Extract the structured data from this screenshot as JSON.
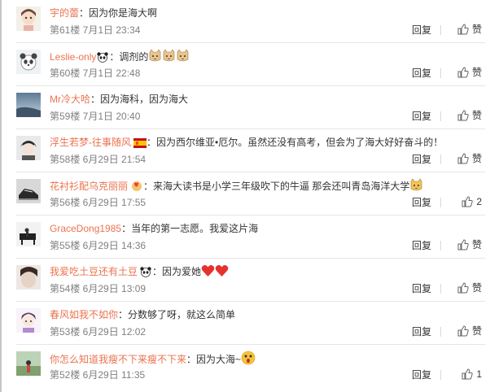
{
  "comments": [
    {
      "username": "宇的蕾",
      "colon": "：",
      "text": "因为你是海大啊",
      "meta": "第61楼 7月1日 23:34",
      "reply": "回复",
      "like": "赞",
      "avatar": "avatar-cartoon-girl",
      "badge_icon": ""
    },
    {
      "username": "Leslie-only",
      "colon": "：",
      "text": "调剂的",
      "meta": "第60楼 7月1日 22:48",
      "reply": "回复",
      "like": "赞",
      "avatar": "avatar-panda",
      "badge_icon": "panda-icon",
      "trailing_icons": [
        "cat-face-icon",
        "cat-face-icon",
        "cat-face-icon"
      ]
    },
    {
      "username": "Mr冷大哈",
      "colon": "：",
      "text": "因为海科，因为海大",
      "meta": "第59楼 7月1日 20:40",
      "reply": "回复",
      "like": "赞",
      "avatar": "avatar-sky",
      "badge_icon": ""
    },
    {
      "username": "浮生若梦-往事随风",
      "colon": "：",
      "text": "因为西尔维亚•厄尔。虽然还没有高考，但会为了海大好好奋斗的！",
      "meta": "第58楼 6月29日 21:54",
      "reply": "回复",
      "like": "赞",
      "avatar": "avatar-anime-boy",
      "badge_icon": "spain-flag-icon"
    },
    {
      "username": "花衬衫配乌克丽丽",
      "colon": "：",
      "text": "来海大读书是小学三年级吹下的牛逼 那会还叫青岛海洋大学",
      "meta": "第56楼 6月29日 17:55",
      "reply": "回复",
      "like": "2",
      "avatar": "avatar-shoe",
      "badge_icon": "heart-hands-icon",
      "trailing_icons": [
        "cat-face-icon"
      ]
    },
    {
      "username": "GraceDong1985",
      "colon": "：",
      "text": "当年的第一志愿。我爱这片海",
      "meta": "第55楼 6月29日 14:36",
      "reply": "回复",
      "like": "赞",
      "avatar": "avatar-piano",
      "badge_icon": ""
    },
    {
      "username": "我爱吃土豆还有土豆",
      "colon": "：",
      "text": "因为爱她",
      "meta": "第54楼 6月29日 13:09",
      "reply": "回复",
      "like": "赞",
      "avatar": "avatar-face",
      "badge_icon": "panda-icon",
      "trailing_icons": [
        "red-heart-icon",
        "red-heart-icon"
      ]
    },
    {
      "username": "春风如我不如你",
      "colon": "：",
      "text": "分数够了呀，就这么简单",
      "meta": "第53楼 6月29日 12:02",
      "reply": "回复",
      "like": "赞",
      "avatar": "avatar-cartoon-boy",
      "badge_icon": ""
    },
    {
      "username": "你怎么知道我瘦不下来瘦不下来",
      "colon": "：",
      "text": "因为大海~",
      "meta": "第52楼 6月29日 11:35",
      "reply": "回复",
      "like": "1",
      "avatar": "avatar-landscape",
      "badge_icon": "",
      "trailing_icons": [
        "surprised-face-icon"
      ]
    }
  ],
  "colors": {
    "username": "#eb7350",
    "meta": "#808080",
    "text": "#333333"
  }
}
